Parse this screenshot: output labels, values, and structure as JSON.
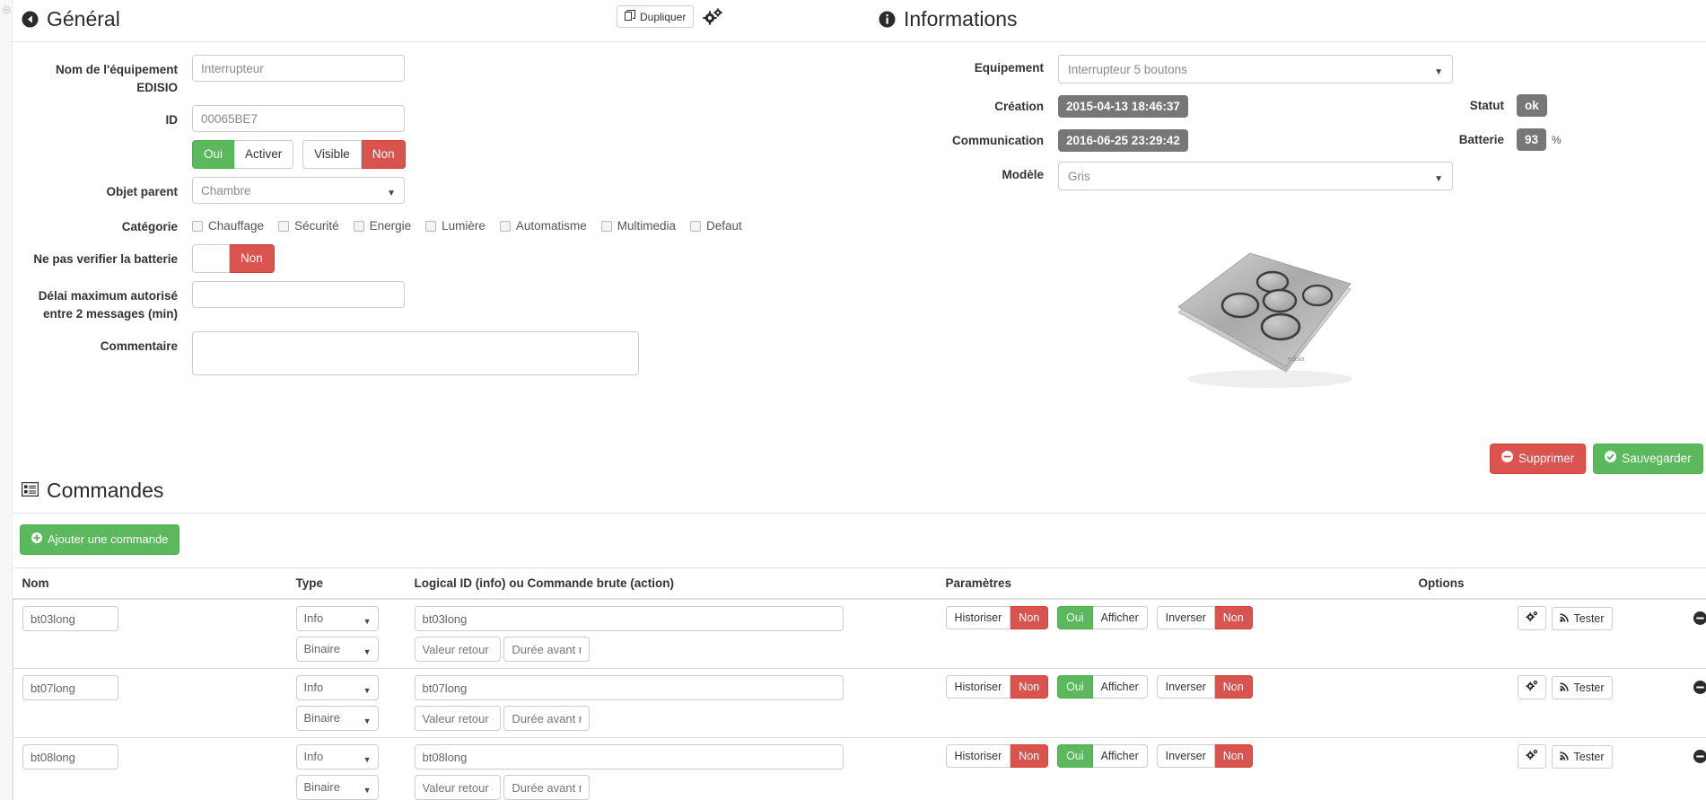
{
  "colors": {
    "green": "#5cb85c",
    "red": "#d9534f",
    "pill_grey": "#777777"
  },
  "gutter": {
    "icon": "collapse-dot"
  },
  "general": {
    "title": "Général",
    "title_icon": "arrow-circle-left-icon",
    "duplicate_label": "Dupliquer",
    "duplicate_icon": "copy-icon",
    "gear_icon": "cogs-icon",
    "fields": {
      "name_label": "Nom de l'équipement EDISIO",
      "name_value": "Interrupteur",
      "id_label": "ID",
      "id_value": "00065BE7",
      "parent_label": "Objet parent",
      "parent_value": "Chambre",
      "category_label": "Catégorie",
      "nobattery_label": "Ne pas verifier la batterie",
      "delay_label": "Délai maximum autorisé entre 2 messages (min)",
      "delay_value": "",
      "comment_label": "Commentaire",
      "comment_value": ""
    },
    "toggles": {
      "enable_on": "Oui",
      "enable_off": "Activer",
      "visible_on": "Visible",
      "visible_off": "Non",
      "battery_on": "",
      "battery_off": "Non"
    },
    "categories": [
      {
        "label": "Chauffage",
        "checked": false
      },
      {
        "label": "Sécurité",
        "checked": false
      },
      {
        "label": "Energie",
        "checked": false
      },
      {
        "label": "Lumière",
        "checked": false
      },
      {
        "label": "Automatisme",
        "checked": false
      },
      {
        "label": "Multimedia",
        "checked": false
      },
      {
        "label": "Defaut",
        "checked": false
      }
    ]
  },
  "informations": {
    "title": "Informations",
    "title_icon": "info-circle-icon",
    "equipement_label": "Equipement",
    "equipement_value": "Interrupteur 5 boutons",
    "creation_label": "Création",
    "creation_value": "2015-04-13 18:46:37",
    "communication_label": "Communication",
    "communication_value": "2016-06-25 23:29:42",
    "modele_label": "Modèle",
    "modele_value": "Gris",
    "statut_label": "Statut",
    "statut_value": "ok",
    "batterie_label": "Batterie",
    "batterie_value": "93",
    "batterie_unit": "%",
    "device_image_alt": "interrupteur-5-boutons-gris"
  },
  "actions": {
    "delete_label": "Supprimer",
    "delete_icon": "minus-circle-icon",
    "save_label": "Sauvegarder",
    "save_icon": "check-circle-icon"
  },
  "commandes": {
    "title": "Commandes",
    "title_icon": "list-alt-icon",
    "add_label": "Ajouter une commande",
    "add_icon": "plus-circle-icon",
    "headers": {
      "nom": "Nom",
      "type": "Type",
      "logical": "Logical ID (info) ou Commande brute (action)",
      "parametres": "Paramètres",
      "options": "Options",
      "actions": ""
    },
    "placeholders": {
      "valeur_retour": "Valeur retour d'état",
      "duree_avant": "Durée avant retour d'état"
    },
    "param_labels": {
      "historiser": "Historiser",
      "historiser_state": "Non",
      "afficher_state": "Oui",
      "afficher": "Afficher",
      "inverser": "Inverser",
      "inverser_state": "Non"
    },
    "option_buttons": {
      "config_icon": "cogs-icon",
      "test_label": "Tester",
      "test_icon": "rss-icon",
      "remove_icon": "minus-circle-icon"
    },
    "rows": [
      {
        "nom": "bt03long",
        "type": "Info",
        "subtype": "Binaire",
        "logical_id": "bt03long",
        "valeur_retour": "",
        "duree": ""
      },
      {
        "nom": "bt07long",
        "type": "Info",
        "subtype": "Binaire",
        "logical_id": "bt07long",
        "valeur_retour": "",
        "duree": ""
      },
      {
        "nom": "bt08long",
        "type": "Info",
        "subtype": "Binaire",
        "logical_id": "bt08long",
        "valeur_retour": "",
        "duree": ""
      }
    ]
  }
}
